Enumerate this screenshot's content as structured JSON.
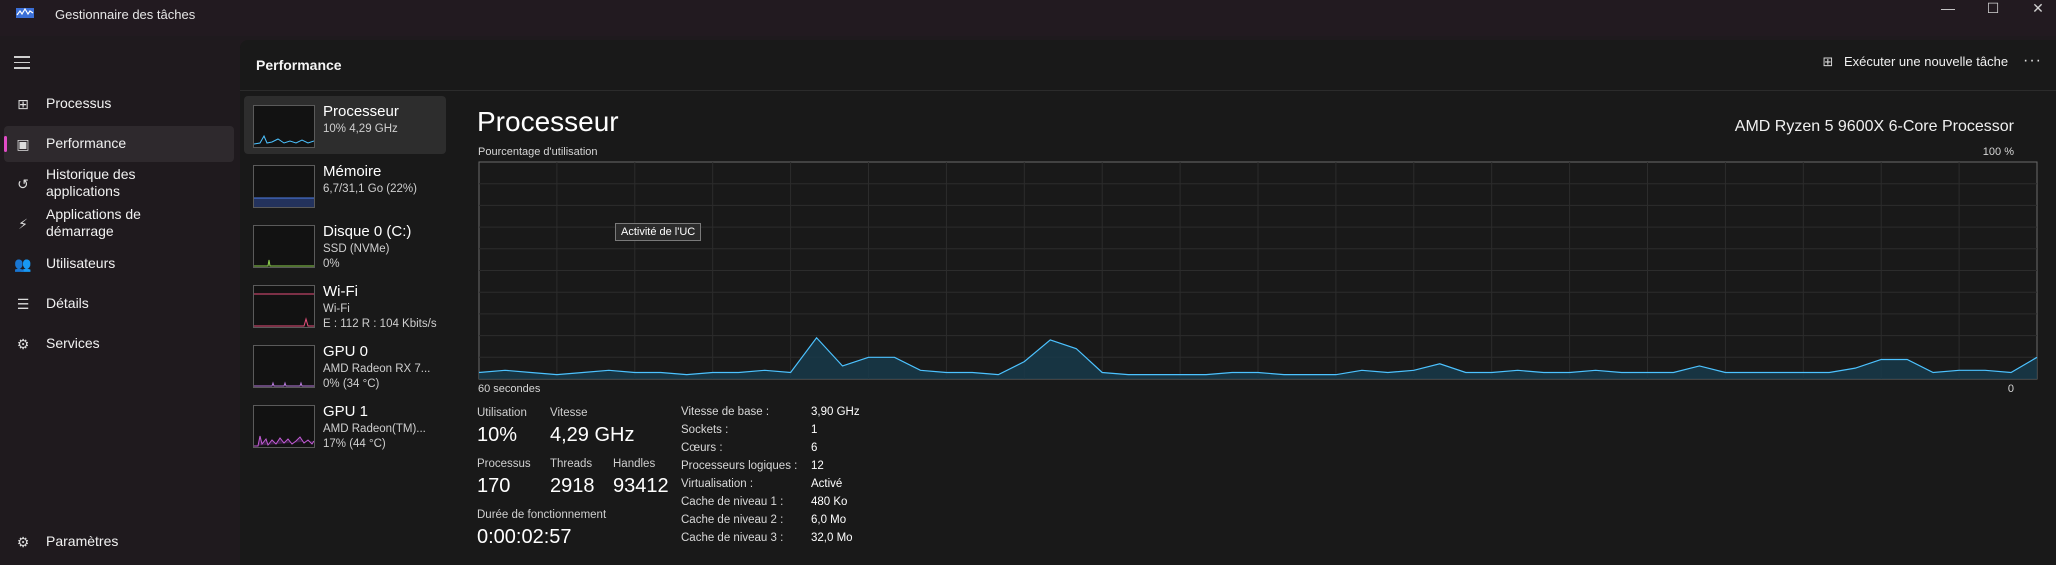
{
  "window": {
    "title": "Gestionnaire des tâches",
    "controls": [
      "—",
      "☐",
      "✕"
    ]
  },
  "sidebar": {
    "menu_icon": "hamburger-icon",
    "items": [
      {
        "label": "Processus",
        "icon": "processes-icon",
        "glyph": "⊞"
      },
      {
        "label": "Performance",
        "icon": "performance-icon",
        "glyph": "▣",
        "active": true
      },
      {
        "label": "Historique des applications",
        "icon": "history-icon",
        "glyph": "↺"
      },
      {
        "label": "Applications de démarrage",
        "icon": "startup-icon",
        "glyph": "⚡"
      },
      {
        "label": "Utilisateurs",
        "icon": "users-icon",
        "glyph": "👥"
      },
      {
        "label": "Détails",
        "icon": "details-icon",
        "glyph": "☰"
      },
      {
        "label": "Services",
        "icon": "services-icon",
        "glyph": "⚙"
      }
    ],
    "settings": {
      "label": "Paramètres",
      "icon": "settings-icon",
      "glyph": "⚙"
    }
  },
  "header": {
    "title": "Performance",
    "run_task": "Exécuter une nouvelle tâche",
    "more": "···"
  },
  "resources": [
    {
      "name": "Processeur",
      "sub": [
        "10% 4,29 GHz"
      ],
      "color": "#4cc2ff",
      "active": true
    },
    {
      "name": "Mémoire",
      "sub": [
        "6,7/31,1 Go (22%)"
      ],
      "color": "#4f7ee8"
    },
    {
      "name": "Disque 0 (C:)",
      "sub": [
        "SSD (NVMe)",
        "0%"
      ],
      "color": "#8fd14f"
    },
    {
      "name": "Wi-Fi",
      "sub": [
        "Wi-Fi",
        "E : 112 R : 104 Kbits/s"
      ],
      "color": "#e64f7a"
    },
    {
      "name": "GPU 0",
      "sub": [
        "AMD Radeon RX 7...",
        "0% (34 °C)"
      ],
      "color": "#b77bdc"
    },
    {
      "name": "GPU 1",
      "sub": [
        "AMD Radeon(TM)...",
        "17% (44 °C)"
      ],
      "color": "#c35cd6"
    }
  ],
  "cpu": {
    "title": "Processeur",
    "model": "AMD Ryzen 5 9600X 6-Core Processor",
    "graph_label": "Pourcentage d'utilisation",
    "graph_max": "100 %",
    "axis_left": "60 secondes",
    "axis_right": "0",
    "tooltip": "Activité de l'UC",
    "stats": {
      "utilisation_label": "Utilisation",
      "utilisation": "10%",
      "vitesse_label": "Vitesse",
      "vitesse": "4,29 GHz",
      "processus_label": "Processus",
      "processus": "170",
      "threads_label": "Threads",
      "threads": "2918",
      "handles_label": "Handles",
      "handles": "93412",
      "uptime_label": "Durée de fonctionnement",
      "uptime": "0:00:02:57"
    },
    "specs": [
      {
        "k": "Vitesse de base :",
        "v": "3,90 GHz"
      },
      {
        "k": "Sockets :",
        "v": "1"
      },
      {
        "k": "Cœurs :",
        "v": "6"
      },
      {
        "k": "Processeurs logiques :",
        "v": "12"
      },
      {
        "k": "Virtualisation :",
        "v": "Activé"
      },
      {
        "k": "Cache de niveau 1 :",
        "v": "480 Ko"
      },
      {
        "k": "Cache de niveau 2 :",
        "v": "6,0 Mo"
      },
      {
        "k": "Cache de niveau 3 :",
        "v": "32,0 Mo"
      }
    ]
  },
  "chart_data": {
    "type": "area",
    "x_seconds_ago": [
      60,
      59,
      58,
      57,
      56,
      55,
      54,
      53,
      52,
      51,
      50,
      49,
      48,
      47,
      46,
      45,
      44,
      43,
      42,
      41,
      40,
      39,
      38,
      37,
      36,
      35,
      34,
      33,
      32,
      31,
      30,
      29,
      28,
      27,
      26,
      25,
      24,
      23,
      22,
      21,
      20,
      19,
      18,
      17,
      16,
      15,
      14,
      13,
      12,
      11,
      10,
      9,
      8,
      7,
      6,
      5,
      4,
      3,
      2,
      1,
      0
    ],
    "y": [
      3,
      4,
      3,
      2,
      3,
      4,
      3,
      3,
      2,
      3,
      3,
      4,
      3,
      19,
      6,
      10,
      10,
      4,
      3,
      3,
      2,
      8,
      18,
      14,
      3,
      2,
      2,
      2,
      2,
      3,
      3,
      2,
      2,
      2,
      4,
      3,
      4,
      7,
      3,
      3,
      4,
      3,
      3,
      4,
      3,
      3,
      3,
      6,
      3,
      3,
      3,
      3,
      3,
      5,
      9,
      9,
      3,
      4,
      4,
      3,
      10
    ],
    "ylim": [
      0,
      100
    ],
    "color": "#4cc2ff"
  }
}
